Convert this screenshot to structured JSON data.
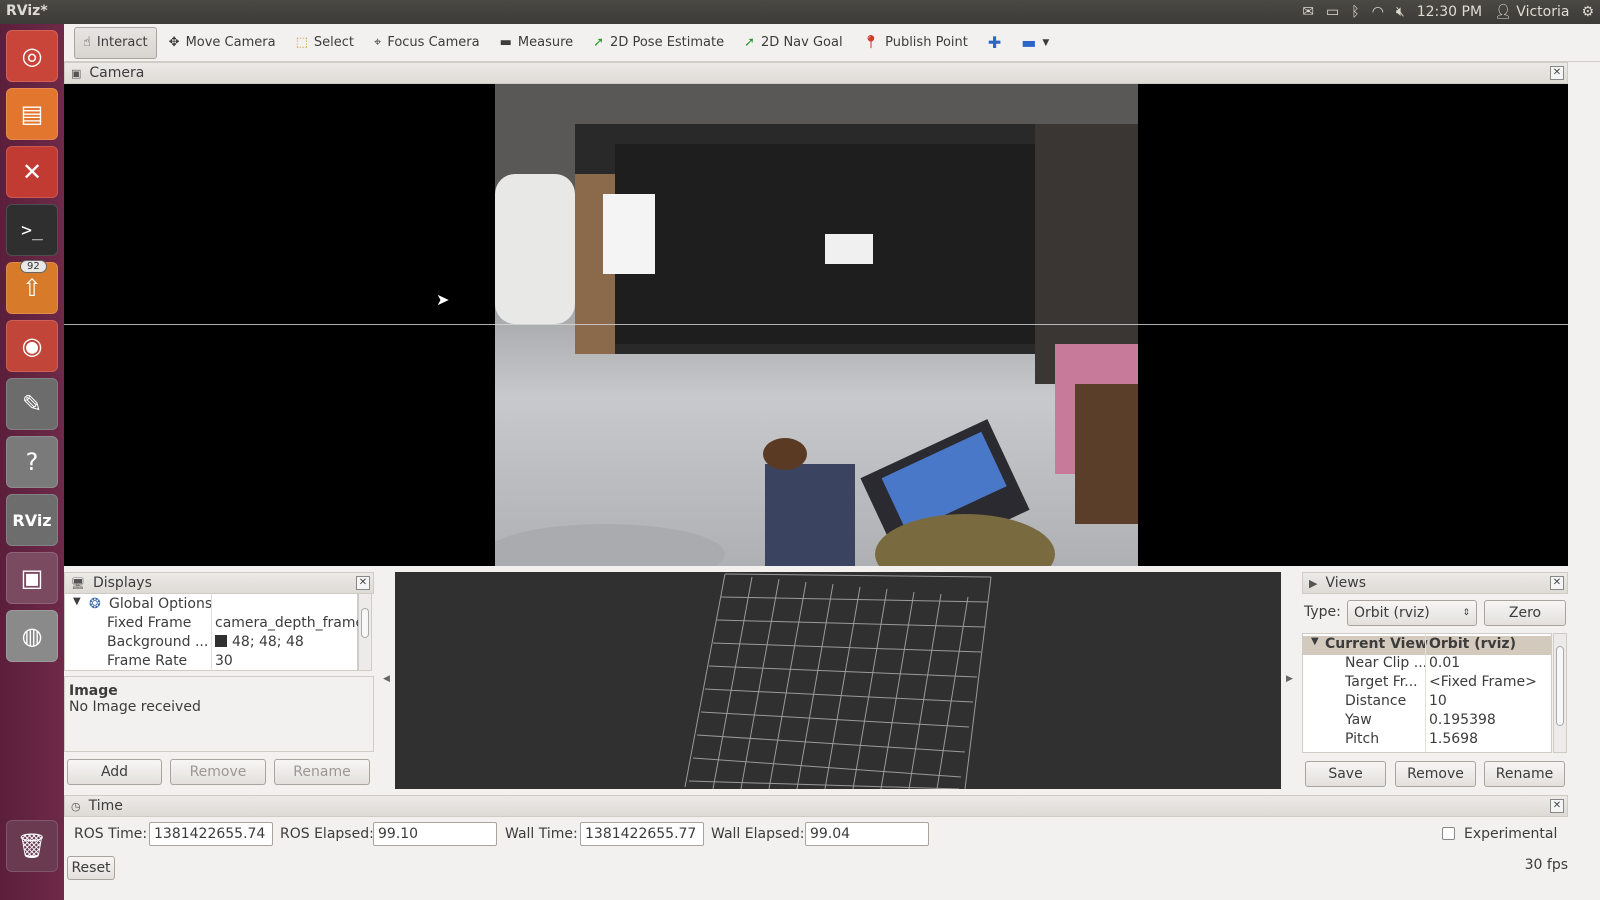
{
  "top_panel": {
    "app_title": "RViz*",
    "clock": "12:30 PM",
    "user": "Victoria",
    "icons": [
      "mail-icon",
      "battery-icon",
      "bluetooth-icon",
      "wifi-icon",
      "volume-muted-icon",
      "gear-icon"
    ]
  },
  "launcher": {
    "items": [
      {
        "name": "ubuntu-dash-icon"
      },
      {
        "name": "files-icon"
      },
      {
        "name": "system-settings-icon"
      },
      {
        "name": "terminal-icon"
      },
      {
        "name": "software-updater-icon",
        "badge": "92"
      },
      {
        "name": "chrome-icon"
      },
      {
        "name": "text-editor-icon"
      },
      {
        "name": "help-icon"
      },
      {
        "name": "rviz-icon"
      },
      {
        "name": "window-icon"
      },
      {
        "name": "dvd-icon"
      },
      {
        "name": "trash-icon"
      }
    ]
  },
  "toolbar": {
    "tools": [
      {
        "label": "Interact",
        "icon": "hand-icon"
      },
      {
        "label": "Move Camera",
        "icon": "move-camera-icon"
      },
      {
        "label": "Select",
        "icon": "select-icon"
      },
      {
        "label": "Focus Camera",
        "icon": "focus-camera-icon"
      },
      {
        "label": "Measure",
        "icon": "ruler-icon"
      },
      {
        "label": "2D Pose Estimate",
        "icon": "pose-arrow-icon"
      },
      {
        "label": "2D Nav Goal",
        "icon": "nav-goal-arrow-icon"
      },
      {
        "label": "Publish Point",
        "icon": "map-pin-icon"
      }
    ]
  },
  "camera_panel": {
    "title": "Camera"
  },
  "displays_panel": {
    "title": "Displays",
    "tree": [
      {
        "label": "Global Options",
        "value": ""
      },
      {
        "label": "Fixed Frame",
        "value": "camera_depth_frame"
      },
      {
        "label": "Background ...",
        "value": "48; 48; 48"
      },
      {
        "label": "Frame Rate",
        "value": "30"
      }
    ],
    "image_status_title": "Image",
    "image_status_text": "No Image received",
    "buttons": {
      "add": "Add",
      "remove": "Remove",
      "rename": "Rename"
    }
  },
  "views_panel": {
    "title": "Views",
    "type_label": "Type:",
    "type_value": "Orbit (rviz)",
    "zero_label": "Zero",
    "tree": [
      {
        "label": "Current View",
        "value": "Orbit (rviz)"
      },
      {
        "label": "Near Clip ...",
        "value": "0.01"
      },
      {
        "label": "Target Fr...",
        "value": "<Fixed Frame>"
      },
      {
        "label": "Distance",
        "value": "10"
      },
      {
        "label": "Yaw",
        "value": "0.195398"
      },
      {
        "label": "Pitch",
        "value": "1.5698"
      }
    ],
    "buttons": {
      "save": "Save",
      "remove": "Remove",
      "rename": "Rename"
    }
  },
  "time_panel": {
    "title": "Time",
    "ros_time_label": "ROS Time:",
    "ros_time": "1381422655.74",
    "ros_elapsed_label": "ROS Elapsed:",
    "ros_elapsed": "99.10",
    "wall_time_label": "Wall Time:",
    "wall_time": "1381422655.77",
    "wall_elapsed_label": "Wall Elapsed:",
    "wall_elapsed": "99.04",
    "experimental_label": "Experimental",
    "experimental_checked": false
  },
  "status_bar": {
    "reset_label": "Reset",
    "fps": "30 fps"
  },
  "colors": {
    "background_swatch": "#303030",
    "launcher": "#5e2440",
    "active_tool": "#d8d5d0"
  }
}
